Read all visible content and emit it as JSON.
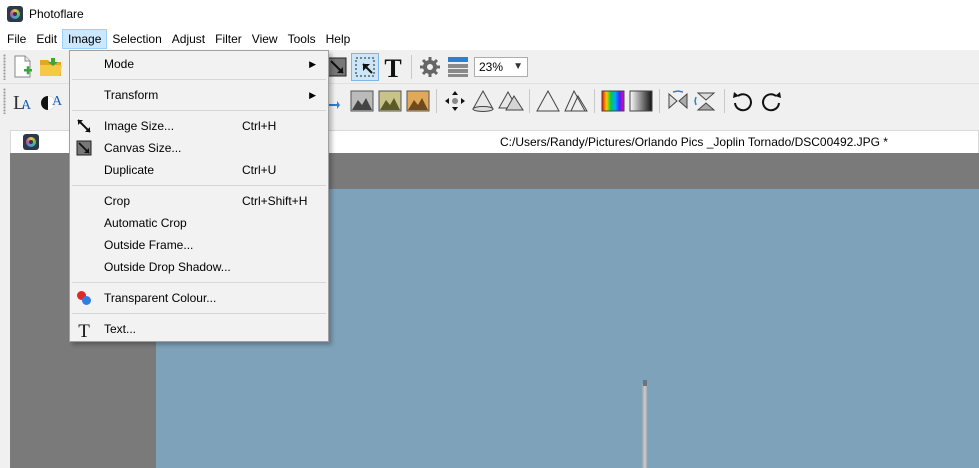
{
  "window": {
    "title": "Photoflare"
  },
  "menubar": {
    "items": [
      {
        "label": "File"
      },
      {
        "label": "Edit"
      },
      {
        "label": "Image"
      },
      {
        "label": "Selection"
      },
      {
        "label": "Adjust"
      },
      {
        "label": "Filter"
      },
      {
        "label": "View"
      },
      {
        "label": "Tools"
      },
      {
        "label": "Help"
      }
    ]
  },
  "toolbar": {
    "zoom_value": "23%"
  },
  "document": {
    "path": "C:/Users/Randy/Pictures/Orlando Pics _Joplin Tornado/DSC00492.JPG *"
  },
  "image_menu": {
    "mode": "Mode",
    "transform": "Transform",
    "image_size": "Image Size...",
    "image_size_shortcut": "Ctrl+H",
    "canvas_size": "Canvas Size...",
    "duplicate": "Duplicate",
    "duplicate_shortcut": "Ctrl+U",
    "crop": "Crop",
    "crop_shortcut": "Ctrl+Shift+H",
    "automatic_crop": "Automatic Crop",
    "outside_frame": "Outside Frame...",
    "outside_drop_shadow": "Outside Drop Shadow...",
    "transparent_colour": "Transparent Colour...",
    "text": "Text..."
  },
  "colors": {
    "menu_highlight": "#cce8ff",
    "selected_tool": "#cde6f7",
    "sky": "#7fa2bb",
    "canvas_bg": "#7a7a7a"
  }
}
